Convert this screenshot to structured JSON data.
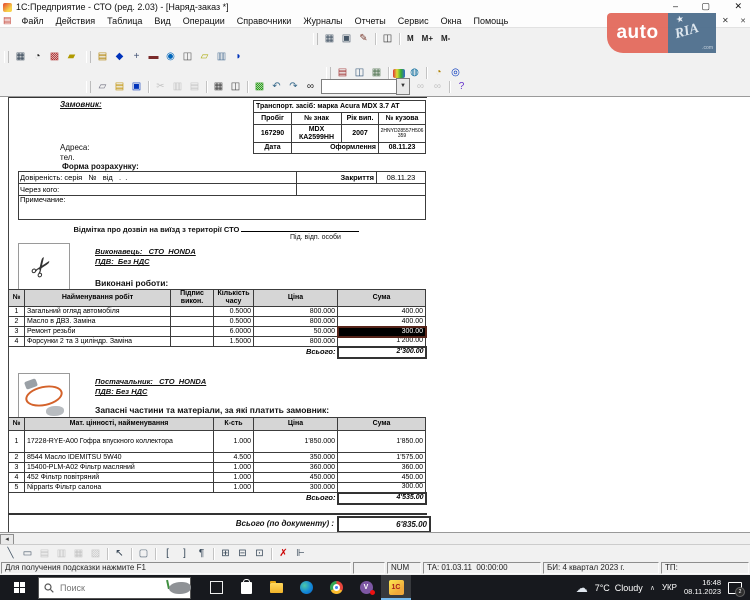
{
  "window": {
    "title": "1С:Предприятие - СТО (ред. 2.03) - [Наряд-заказ *]",
    "minimize": "–",
    "maximize": "▢",
    "close": "✕",
    "mdi_close": "✕"
  },
  "menu": {
    "items": [
      "Файл",
      "Действия",
      "Таблица",
      "Вид",
      "Операции",
      "Справочники",
      "Журналы",
      "Отчеты",
      "Сервис",
      "Окна",
      "Помощь"
    ]
  },
  "toolbars": {
    "row_a": [
      {
        "n": "table-settings",
        "g": "▦",
        "c": "#445566"
      },
      {
        "n": "page-setup",
        "g": "▣",
        "c": "#445566"
      },
      {
        "n": "sign",
        "g": "✎",
        "c": "#7a3b2e"
      },
      {
        "s": 1
      },
      {
        "n": "book",
        "g": "◫",
        "c": "#333333"
      },
      {
        "s": 1
      },
      {
        "n": "memory",
        "t": "М"
      },
      {
        "n": "memory-add",
        "t": "М+"
      },
      {
        "n": "memory-sub",
        "t": "М-"
      }
    ],
    "row_b1": [
      {
        "n": "journal",
        "g": "▦",
        "c": "#334455"
      },
      {
        "n": "time",
        "g": "◔",
        "c": "#222222"
      },
      {
        "n": "design",
        "g": "▩",
        "c": "#b03030"
      },
      {
        "n": "vehicle",
        "g": "▰",
        "c": "#b09a00"
      }
    ],
    "row_b2": [
      {
        "n": "new-doc",
        "g": "▤",
        "c": "#b08000"
      },
      {
        "n": "nav-cube",
        "g": "◆",
        "c": "#0033bb"
      },
      {
        "n": "add-entry",
        "g": "+",
        "c": "#445577"
      },
      {
        "n": "remove-entry",
        "g": "▬",
        "c": "#7a2a2a"
      },
      {
        "n": "find-entry",
        "g": "◉",
        "c": "#0066bb"
      },
      {
        "n": "hierarchy",
        "g": "◫",
        "c": "#555555"
      },
      {
        "n": "memo",
        "g": "▱",
        "c": "#a8a800"
      },
      {
        "n": "catalog",
        "g": "▥",
        "c": "#557799"
      },
      {
        "n": "exit-boot",
        "g": "◗",
        "c": "#0033bb"
      }
    ],
    "row_c": [
      {
        "n": "report",
        "g": "▤",
        "c": "#a03030"
      },
      {
        "n": "requisites",
        "g": "◫",
        "c": "#335577"
      },
      {
        "n": "grid",
        "g": "▦",
        "c": "#557755"
      },
      {
        "s": 1
      },
      {
        "n": "palette",
        "g": "▉",
        "k": "rainbow"
      },
      {
        "n": "globe",
        "g": "◍",
        "c": "#006699"
      },
      {
        "s": 1
      },
      {
        "n": "history",
        "g": "◔",
        "c": "#b08000"
      },
      {
        "n": "zoom",
        "g": "◎",
        "c": "#0033bb"
      }
    ],
    "row_d1": [
      {
        "n": "new",
        "g": "▱",
        "c": "#666677"
      },
      {
        "n": "open",
        "g": "▤",
        "c": "#c09000"
      },
      {
        "n": "save",
        "g": "▣",
        "c": "#0033bb"
      },
      {
        "s": 1
      },
      {
        "n": "cut",
        "g": "✂",
        "c": "#555555",
        "d": 1
      },
      {
        "n": "copy",
        "g": "▥",
        "c": "#556677",
        "d": 1
      },
      {
        "n": "paste",
        "g": "▤",
        "c": "#556677",
        "d": 1
      },
      {
        "s": 1
      },
      {
        "n": "print",
        "g": "▦",
        "c": "#444444"
      },
      {
        "n": "print-preview",
        "g": "◫",
        "c": "#444444"
      },
      {
        "s": 1
      },
      {
        "n": "view-mode",
        "g": "▩",
        "c": "#229911"
      },
      {
        "n": "undo",
        "g": "↶",
        "c": "#336688"
      },
      {
        "n": "redo",
        "g": "↷",
        "c": "#336688"
      },
      {
        "n": "find",
        "g": "∞",
        "c": "#222222"
      }
    ],
    "row_d2": [
      {
        "n": "find-next",
        "g": "∞",
        "c": "#555555",
        "d": 1
      },
      {
        "n": "find-prev",
        "g": "∞",
        "c": "#555555",
        "d": 1
      },
      {
        "s": 1
      },
      {
        "n": "help",
        "g": "?",
        "c": "#6633cc"
      }
    ],
    "draw": [
      {
        "n": "line-tool",
        "g": "╲",
        "c": "#445566"
      },
      {
        "n": "rect-tool",
        "g": "▭",
        "c": "#445566"
      },
      {
        "n": "picture-tool",
        "g": "▤",
        "c": "#445566",
        "d": 1
      },
      {
        "n": "ole-tool",
        "g": "▥",
        "c": "#445566",
        "d": 1
      },
      {
        "n": "diagram-tool",
        "g": "▦",
        "c": "#445566",
        "d": 1
      },
      {
        "n": "text-tool",
        "g": "▨",
        "c": "#445566",
        "d": 1
      },
      {
        "s": 1
      },
      {
        "n": "cursor-tool",
        "g": "↖",
        "c": "#223344"
      },
      {
        "s": 1
      },
      {
        "n": "frame-tool",
        "g": "▢",
        "c": "#556677"
      },
      {
        "s": 1
      },
      {
        "n": "bracket-open-tool",
        "g": "[",
        "c": "#334455"
      },
      {
        "n": "bracket-close-tool",
        "g": "]",
        "c": "#334455"
      },
      {
        "n": "section-tool",
        "g": "¶",
        "c": "#334455"
      },
      {
        "s": 1
      },
      {
        "n": "table-tool",
        "g": "⊞",
        "c": "#334455"
      },
      {
        "n": "table-header-tool",
        "g": "⊟",
        "c": "#334455"
      },
      {
        "n": "table-cell-tool",
        "g": "⊡",
        "c": "#334455"
      },
      {
        "s": 1
      },
      {
        "n": "hide-grid-tool",
        "g": "✗",
        "c": "#cc0000"
      },
      {
        "n": "fix-table-tool",
        "g": "⊩",
        "c": "#334455"
      }
    ],
    "scroll_left": "◂",
    "combo_dd": "▼"
  },
  "document": {
    "customer_label": "Замовник:",
    "vehicle": {
      "title": "Транспорт. засіб: марка Acura MDX 3.7 AT",
      "h_mileage": "Пробіг",
      "h_plate": "№ знак",
      "h_year": "Рік вип.",
      "h_vin": "№ кузова",
      "mileage": "167290",
      "plate": "MDX КА2599НН",
      "year": "2007",
      "vin": "2HNYD28557H506359",
      "date_label": "Дата",
      "reg_label": "Оформлення",
      "date_value": "08.11.23"
    },
    "address_label": "Адреса:",
    "phone_label": "тел.",
    "payment_label": "Форма розрахунку:",
    "poa_label": "Довіреність: серія   №   від   .  .",
    "closing_label": "Закриття",
    "closing_date": "08.11.23",
    "via_label": "Через кого:",
    "note_label": "Примечание:",
    "exit_label": "Відмітка про дозвіл на виїзд з території СТО",
    "sign_label": "Під. відп. особи",
    "executor": {
      "name": "Виконавець:   СТО  HONDA",
      "vat": "ПДВ:  Без НДС",
      "section": "Виконані роботи:"
    },
    "works": {
      "headers": [
        "№",
        "Найменування робіт",
        "Підпис викон.",
        "Кількість часу",
        "Ціна",
        "Сума"
      ],
      "rows": [
        [
          "1",
          "Загальний огляд автомобіля",
          "",
          "0.5000",
          "800.000",
          "400.00"
        ],
        [
          "2",
          "Масло в ДВЗ. Заміна",
          "",
          "0.5000",
          "800.000",
          "400.00"
        ],
        [
          "3",
          "Ремонт резьби",
          "",
          "6.0000",
          "50.000",
          "300.00"
        ],
        [
          "4",
          "Форсунки 2 та 3 циліндр. Заміна",
          "",
          "1.5000",
          "800.000",
          "1'200.00"
        ]
      ],
      "selected": [
        2,
        5
      ],
      "total_label": "Всього:",
      "total": "2'300.00"
    },
    "supplier": {
      "name": "Постачальник:   СТО  HONDA",
      "vat": "ПДВ: Без НДС",
      "section": "Запасні частини та матеріали, за які платить замовник:"
    },
    "parts": {
      "headers": [
        "№",
        "Мат. цінності, найменування",
        "К-сть",
        "Ціна",
        "Сума"
      ],
      "rows": [
        [
          "1",
          "17228-RYE-A00 Гофра впускного коллектора",
          "1.000",
          "1'850.000",
          "1'850.00"
        ],
        [
          "2",
          "8544 Масло IDEMITSU 5W40",
          "4.500",
          "350.000",
          "1'575.00"
        ],
        [
          "3",
          "15400-PLM-A02 Фільтр масляний",
          "1.000",
          "360.000",
          "360.00"
        ],
        [
          "4",
          "452 Фільтр повітряний",
          "1.000",
          "450.000",
          "450.00"
        ],
        [
          "5",
          "Nipparts Фільтр салона",
          "1.000",
          "300.000",
          "300.00"
        ]
      ],
      "total_label": "Всього:",
      "total": "4'535.00"
    },
    "grand_total_label": "Всього (по документу) :",
    "grand_total": "6'835.00"
  },
  "status": {
    "hint": "Для получения подсказки нажмите F1",
    "num": "NUM",
    "ta": "ТА: 01.03.11  00:00:00",
    "bi": "БИ: 4 квартал 2023 г.",
    "tp": "ТП:"
  },
  "taskbar": {
    "search_placeholder": "Поиск",
    "weather": "7°C  Cloudy",
    "lang": "УКР",
    "time": "16:48",
    "date": "08.11.2023",
    "notif_count": "2",
    "onec_label": "1С",
    "viber_label": "V"
  },
  "watermark": {
    "auto": "auto",
    "ria": "RIA",
    "com": ".com",
    "close": "✕"
  },
  "colors": {
    "accent_red": "#c0392b",
    "watermark_auto": "#e3695c",
    "watermark_ria": "#4f6f8e",
    "taskbar_bg": "#17191e",
    "selection_bg": "#000000",
    "header_cell_bg": "#d6d6d6"
  }
}
